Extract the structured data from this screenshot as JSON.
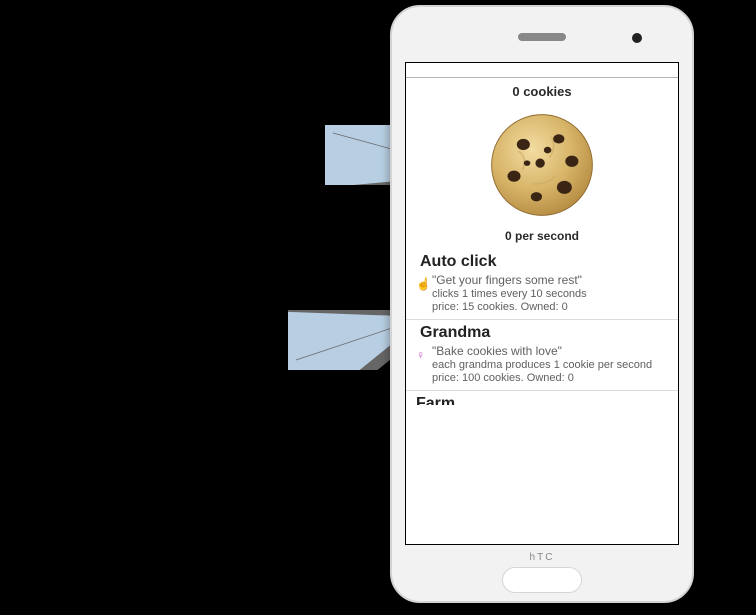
{
  "phone_brand": "hTC",
  "counter": {
    "cookies_label": "0 cookies",
    "per_second_label": "0 per second"
  },
  "upgrades": [
    {
      "title": "Auto click",
      "quote": "\"Get your fingers some rest\"",
      "desc": "clicks 1 times every 10 seconds",
      "price": "price: 15 cookies. Owned: 0",
      "icon_glyph": "☝",
      "icon_style": "auto"
    },
    {
      "title": "Grandma",
      "quote": "\"Bake cookies with love\"",
      "desc": "each grandma produces 1 cookie per second",
      "price": "price: 100 cookies. Owned: 0",
      "icon_glyph": "♀",
      "icon_style": "grandma"
    }
  ],
  "next_partial": "Farm"
}
